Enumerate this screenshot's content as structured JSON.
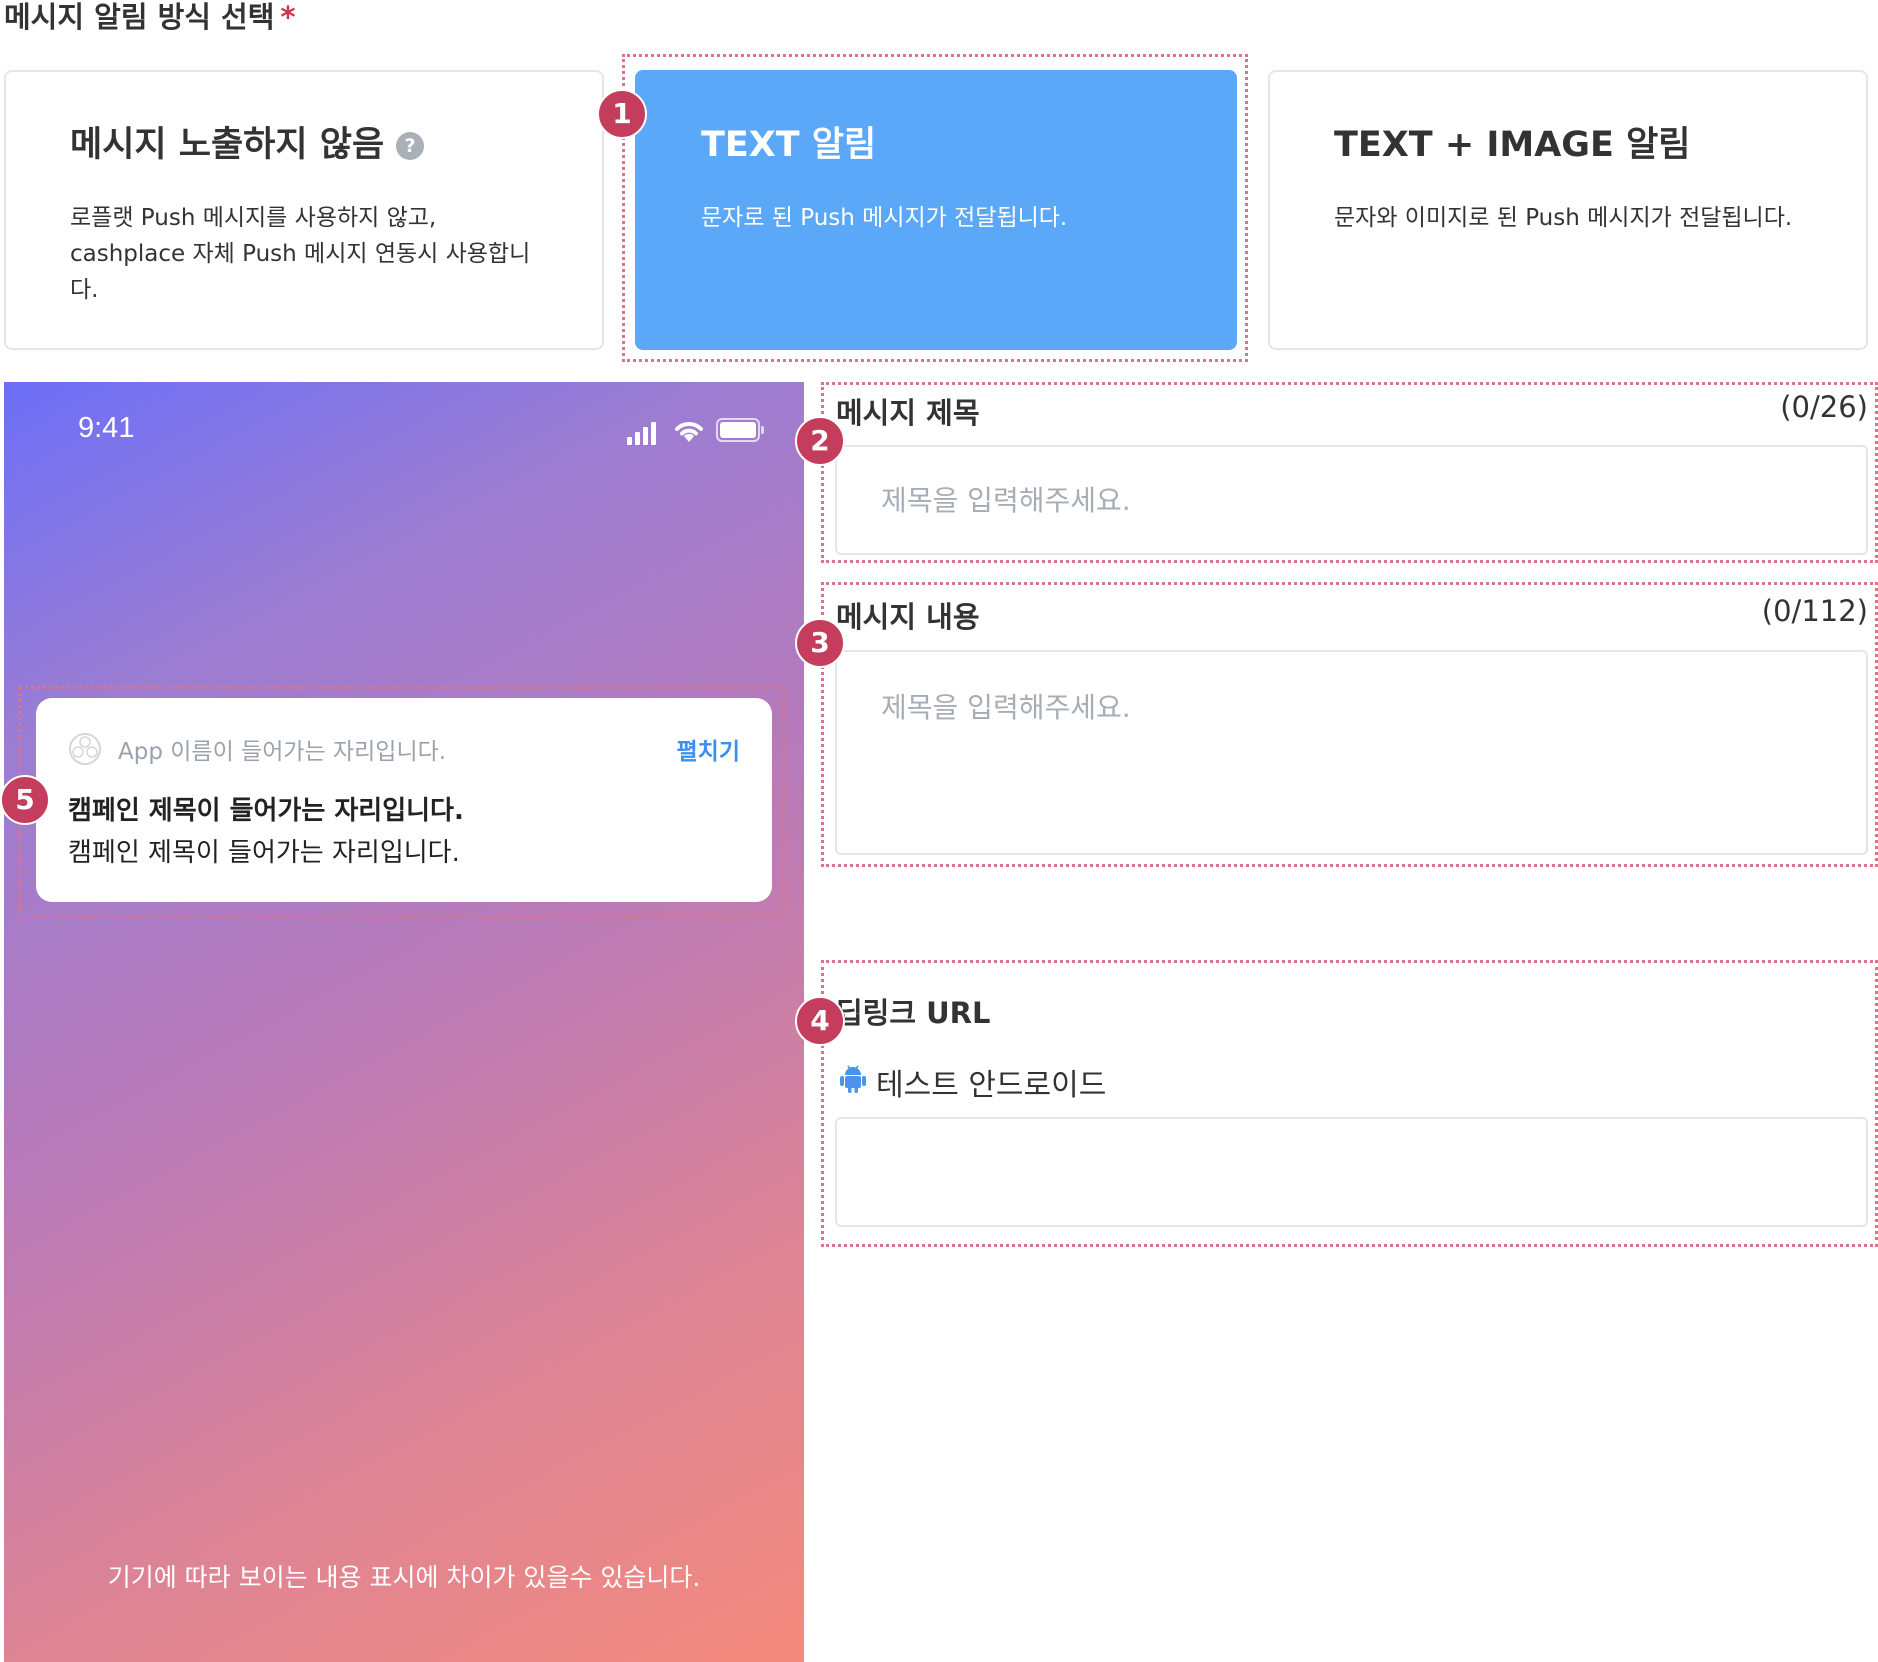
{
  "section": {
    "title": "메시지 알림 방식 선택",
    "required_mark": "*"
  },
  "options": [
    {
      "title": "메시지 노출하지 않음",
      "help_icon": "?",
      "description": "로플랫 Push 메시지를 사용하지 않고, cashplace 자체 Push 메시지 연동시 사용합니다.",
      "selected": false
    },
    {
      "title": "TEXT 알림",
      "description": "문자로 된 Push 메시지가 전달됩니다.",
      "selected": true
    },
    {
      "title": "TEXT + IMAGE 알림",
      "description": "문자와 이미지로 된 Push 메시지가 전달됩니다.",
      "selected": false
    }
  ],
  "badges": [
    "1",
    "2",
    "3",
    "4",
    "5"
  ],
  "phone": {
    "time": "9:41",
    "status_icons": [
      "cellular-signal-icon",
      "wifi-icon",
      "battery-icon"
    ],
    "notification": {
      "app_name": "App 이름이 들어가는 자리입니다.",
      "expand_label": "펼치기",
      "title": "캠페인 제목이 들어가는 자리입니다.",
      "body": "캠페인 제목이 들어가는 자리입니다."
    },
    "footer": "기기에 따라 보이는 내용 표시에 차이가 있을수 있습니다."
  },
  "form": {
    "message_title": {
      "label": "메시지 제목",
      "counter": "(0/26)",
      "placeholder": "제목을 입력해주세요.",
      "value": ""
    },
    "message_content": {
      "label": "메시지 내용",
      "counter": "(0/112)",
      "placeholder": "제목을 입력해주세요.",
      "value": ""
    },
    "deeplink": {
      "label": "딥링크 URL",
      "platform_label": "테스트 안드로이드",
      "value": ""
    }
  },
  "colors": {
    "selected_card": "#5ba7f8",
    "badge": "#c43d5c",
    "annotation_outline": "#d9748a",
    "link": "#3d8ef1"
  }
}
